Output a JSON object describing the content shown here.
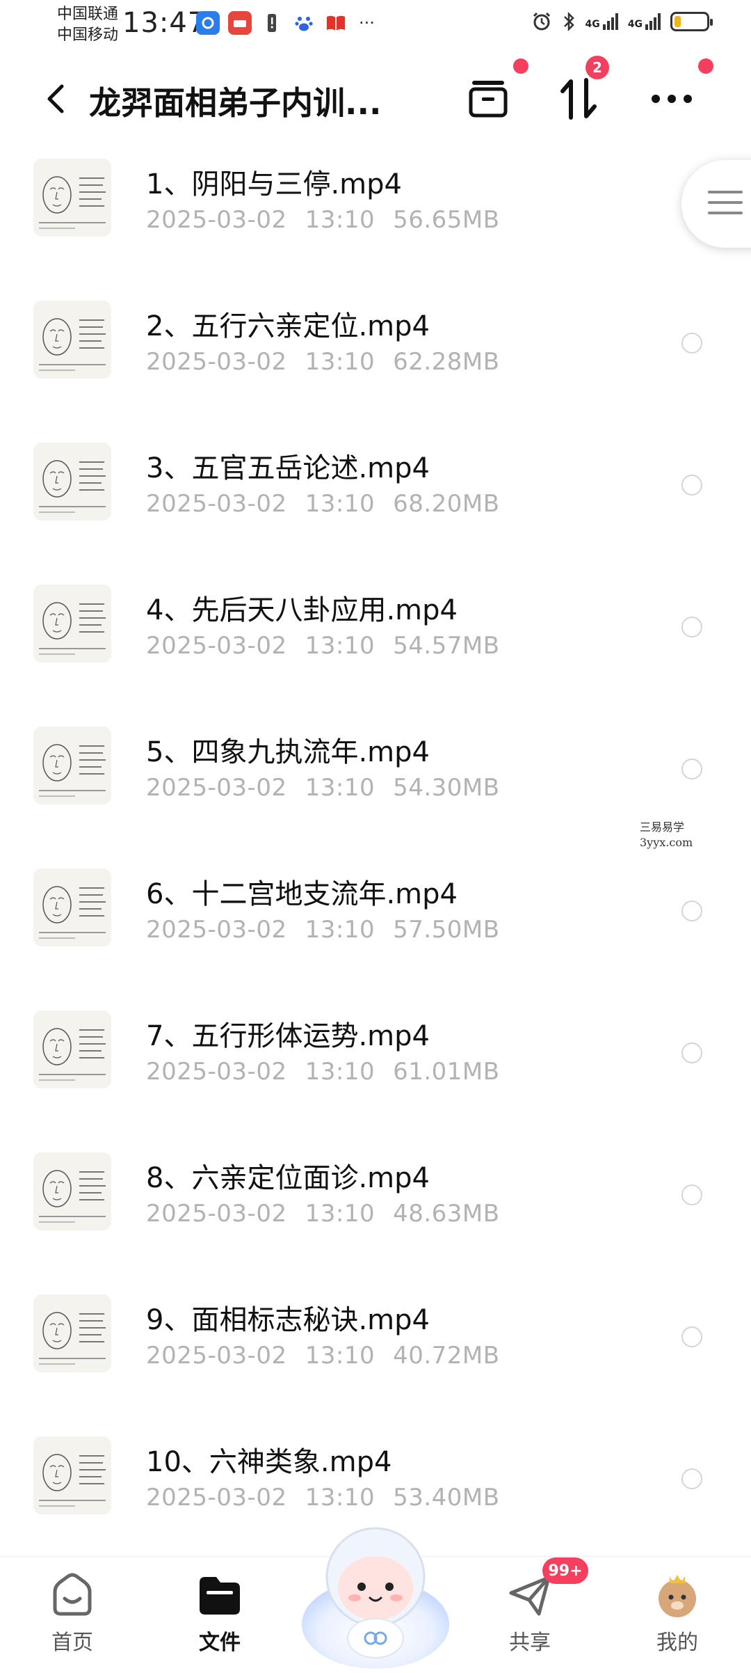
{
  "status_bar": {
    "carrier_1": "中国联通",
    "carrier_2": "中国移动",
    "time": "13:47",
    "network_1": "4G",
    "network_2": "4G",
    "battery_level": 0.2
  },
  "header": {
    "title": "龙羿面相弟子内训...",
    "transfer_badge": "2"
  },
  "files": [
    {
      "name": "1、阴阳与三停.mp4",
      "date": "2025-03-02",
      "time": "13:10",
      "size": "56.65MB"
    },
    {
      "name": "2、五行六亲定位.mp4",
      "date": "2025-03-02",
      "time": "13:10",
      "size": "62.28MB"
    },
    {
      "name": "3、五官五岳论述.mp4",
      "date": "2025-03-02",
      "time": "13:10",
      "size": "68.20MB"
    },
    {
      "name": "4、先后天八卦应用.mp4",
      "date": "2025-03-02",
      "time": "13:10",
      "size": "54.57MB"
    },
    {
      "name": "5、四象九执流年.mp4",
      "date": "2025-03-02",
      "time": "13:10",
      "size": "54.30MB"
    },
    {
      "name": "6、十二宫地支流年.mp4",
      "date": "2025-03-02",
      "time": "13:10",
      "size": "57.50MB"
    },
    {
      "name": "7、五行形体运势.mp4",
      "date": "2025-03-02",
      "time": "13:10",
      "size": "61.01MB"
    },
    {
      "name": "8、六亲定位面诊.mp4",
      "date": "2025-03-02",
      "time": "13:10",
      "size": "48.63MB"
    },
    {
      "name": "9、面相标志秘诀.mp4",
      "date": "2025-03-02",
      "time": "13:10",
      "size": "40.72MB"
    },
    {
      "name": "10、六神类象.mp4",
      "date": "2025-03-02",
      "time": "13:10",
      "size": "53.40MB"
    }
  ],
  "watermark": {
    "line1": "三易易学",
    "line2": "3yyx.com"
  },
  "bottom_nav": {
    "home": "首页",
    "files": "文件",
    "share": "共享",
    "mine": "我的",
    "share_badge": "99+"
  },
  "colors": {
    "accent": "#f43f5e",
    "meta_text": "#b2b2b2"
  }
}
